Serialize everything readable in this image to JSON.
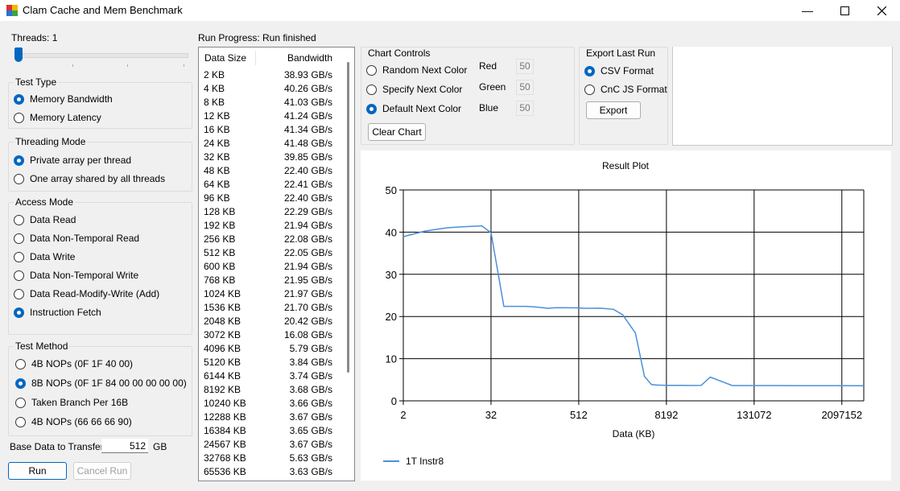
{
  "window": {
    "title": "Clam Cache and Mem Benchmark"
  },
  "threads": {
    "label": "Threads: 1",
    "value": 1
  },
  "test_type": {
    "title": "Test Type",
    "options": [
      "Memory Bandwidth",
      "Memory Latency"
    ],
    "selected": 0
  },
  "threading_mode": {
    "title": "Threading Mode",
    "options": [
      "Private array per thread",
      "One array shared by all threads"
    ],
    "selected": 0
  },
  "access_mode": {
    "title": "Access Mode",
    "options": [
      "Data Read",
      "Data Non-Temporal Read",
      "Data Write",
      "Data Non-Temporal Write",
      "Data Read-Modify-Write (Add)",
      "Instruction Fetch"
    ],
    "selected": 5
  },
  "test_method": {
    "title": "Test Method",
    "options": [
      "4B NOPs (0F 1F 40 00)",
      "8B NOPs (0F 1F 84 00 00 00 00 00)",
      "Taken Branch Per 16B",
      "4B NOPs (66 66 66 90)"
    ],
    "selected": 1
  },
  "base_data": {
    "label": "Base Data to Transfer:",
    "value": "512",
    "unit": "GB"
  },
  "buttons": {
    "run": "Run",
    "cancel": "Cancel Run",
    "clear_chart": "Clear Chart",
    "export": "Export"
  },
  "run_progress": {
    "label": "Run Progress:",
    "status": "Run finished"
  },
  "results": {
    "headers": [
      "Data Size",
      "Bandwidth"
    ],
    "rows": [
      [
        "2 KB",
        "38.93 GB/s"
      ],
      [
        "4 KB",
        "40.26 GB/s"
      ],
      [
        "8 KB",
        "41.03 GB/s"
      ],
      [
        "12 KB",
        "41.24 GB/s"
      ],
      [
        "16 KB",
        "41.34 GB/s"
      ],
      [
        "24 KB",
        "41.48 GB/s"
      ],
      [
        "32 KB",
        "39.85 GB/s"
      ],
      [
        "48 KB",
        "22.40 GB/s"
      ],
      [
        "64 KB",
        "22.41 GB/s"
      ],
      [
        "96 KB",
        "22.40 GB/s"
      ],
      [
        "128 KB",
        "22.29 GB/s"
      ],
      [
        "192 KB",
        "21.94 GB/s"
      ],
      [
        "256 KB",
        "22.08 GB/s"
      ],
      [
        "512 KB",
        "22.05 GB/s"
      ],
      [
        "600 KB",
        "21.94 GB/s"
      ],
      [
        "768 KB",
        "21.95 GB/s"
      ],
      [
        "1024 KB",
        "21.97 GB/s"
      ],
      [
        "1536 KB",
        "21.70 GB/s"
      ],
      [
        "2048 KB",
        "20.42 GB/s"
      ],
      [
        "3072 KB",
        "16.08 GB/s"
      ],
      [
        "4096 KB",
        "5.79 GB/s"
      ],
      [
        "5120 KB",
        "3.84 GB/s"
      ],
      [
        "6144 KB",
        "3.74 GB/s"
      ],
      [
        "8192 KB",
        "3.68 GB/s"
      ],
      [
        "10240 KB",
        "3.66 GB/s"
      ],
      [
        "12288 KB",
        "3.67 GB/s"
      ],
      [
        "16384 KB",
        "3.65 GB/s"
      ],
      [
        "24567 KB",
        "3.67 GB/s"
      ],
      [
        "32768 KB",
        "5.63 GB/s"
      ],
      [
        "65536 KB",
        "3.63 GB/s"
      ]
    ]
  },
  "chart_controls": {
    "title": "Chart Controls",
    "options": [
      "Random Next Color",
      "Specify Next Color",
      "Default Next Color"
    ],
    "selected": 2,
    "color_fields": [
      {
        "label": "Red",
        "value": "50"
      },
      {
        "label": "Green",
        "value": "50"
      },
      {
        "label": "Blue",
        "value": "50"
      }
    ]
  },
  "export": {
    "title": "Export Last Run",
    "options": [
      "CSV Format",
      "CnC JS Format"
    ],
    "selected": 0
  },
  "chart_data": {
    "type": "line",
    "title": "Result Plot",
    "xlabel": "Data (KB)",
    "ylabel": "",
    "x_scale": "log2",
    "x_ticks": [
      "2",
      "32",
      "512",
      "8192",
      "131072",
      "2097152"
    ],
    "y_ticks": [
      "0",
      "10",
      "20",
      "30",
      "40",
      "50"
    ],
    "ylim": [
      0,
      50
    ],
    "xlim": [
      2,
      4194304
    ],
    "grid": true,
    "legend_position": "bottom-left",
    "series": [
      {
        "name": "1T Instr8",
        "color": "#4a90d9",
        "x": [
          2,
          4,
          8,
          12,
          16,
          24,
          32,
          48,
          64,
          96,
          128,
          192,
          256,
          512,
          600,
          768,
          1024,
          1536,
          2048,
          3072,
          4096,
          5120,
          6144,
          8192,
          10240,
          12288,
          16384,
          24567,
          32768,
          65536,
          131072,
          262144,
          524288,
          1048576,
          2097152,
          4194304
        ],
        "y": [
          38.93,
          40.26,
          41.03,
          41.24,
          41.34,
          41.48,
          39.85,
          22.4,
          22.41,
          22.4,
          22.29,
          21.94,
          22.08,
          22.05,
          21.94,
          21.95,
          21.97,
          21.7,
          20.42,
          16.08,
          5.79,
          3.84,
          3.74,
          3.68,
          3.66,
          3.67,
          3.65,
          3.67,
          5.63,
          3.63,
          3.62,
          3.62,
          3.61,
          3.61,
          3.6,
          3.58
        ]
      }
    ]
  }
}
